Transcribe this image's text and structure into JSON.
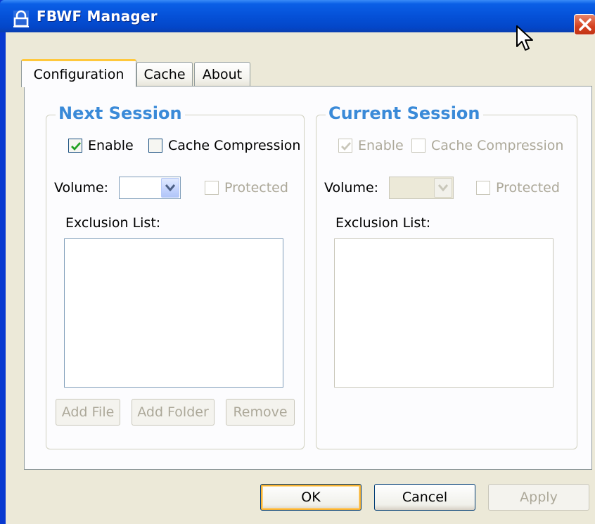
{
  "window": {
    "title": "FBWF Manager"
  },
  "tabs": [
    {
      "label": "Configuration",
      "active": true
    },
    {
      "label": "Cache",
      "active": false
    },
    {
      "label": "About",
      "active": false
    }
  ],
  "next_session": {
    "title": "Next Session",
    "enable_label": "Enable",
    "enable_checked": true,
    "cache_compression_label": "Cache Compression",
    "cache_compression_checked": false,
    "volume_label": "Volume:",
    "volume_value": "",
    "protected_label": "Protected",
    "protected_checked": false,
    "exclusion_list_label": "Exclusion List:",
    "exclusion_items": [],
    "add_file_label": "Add File",
    "add_folder_label": "Add Folder",
    "remove_label": "Remove"
  },
  "current_session": {
    "title": "Current Session",
    "enable_label": "Enable",
    "enable_checked": true,
    "cache_compression_label": "Cache Compression",
    "cache_compression_checked": false,
    "volume_label": "Volume:",
    "volume_value": "",
    "protected_label": "Protected",
    "protected_checked": false,
    "exclusion_list_label": "Exclusion List:",
    "exclusion_items": []
  },
  "footer": {
    "ok_label": "OK",
    "cancel_label": "Cancel",
    "apply_label": "Apply"
  },
  "colors": {
    "titlebar": "#0551d8",
    "group_title": "#3a8ad8",
    "default_button_ring": "#f8b232",
    "close_button": "#d4401f"
  }
}
